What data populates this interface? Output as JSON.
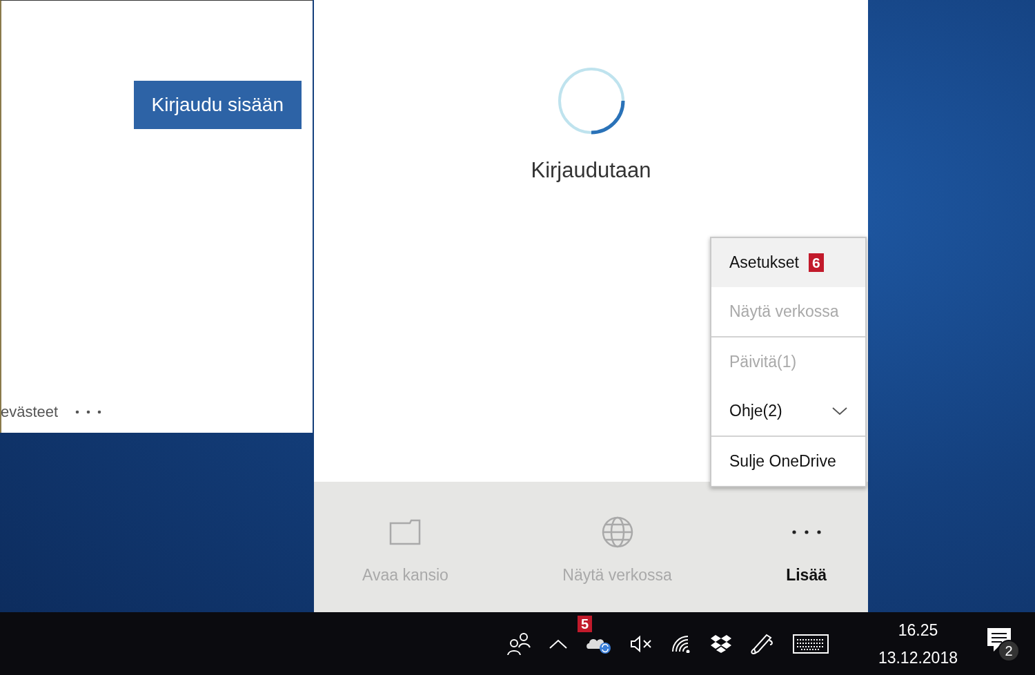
{
  "signin_window": {
    "button": "Kirjaudu sisään",
    "footer_text": "evästeet"
  },
  "onedrive_panel": {
    "status": "Kirjaudutaan",
    "menu": {
      "groups": [
        [
          {
            "label": "Asetukset",
            "disabled": false,
            "highlighted": true,
            "badge": "6"
          },
          {
            "label": "Näytä verkossa",
            "disabled": true,
            "highlighted": false
          }
        ],
        [
          {
            "label": "Päivitä(1)",
            "disabled": true,
            "highlighted": false
          },
          {
            "label": "Ohje(2)",
            "disabled": false,
            "highlighted": false,
            "submenu": true
          }
        ],
        [
          {
            "label": "Sulje OneDrive",
            "disabled": false,
            "highlighted": false
          }
        ]
      ]
    },
    "actions": [
      {
        "kind": "folder",
        "label": "Avaa kansio",
        "disabled": true
      },
      {
        "kind": "globe",
        "label": "Näytä verkossa",
        "disabled": true
      },
      {
        "kind": "more",
        "label": "Lisää",
        "disabled": false
      }
    ]
  },
  "taskbar": {
    "tray": [
      {
        "kind": "people"
      },
      {
        "kind": "chevron"
      },
      {
        "kind": "cloud",
        "badge": "5"
      },
      {
        "kind": "muted"
      },
      {
        "kind": "wifi"
      },
      {
        "kind": "dropbox"
      },
      {
        "kind": "pen"
      },
      {
        "kind": "keyboard"
      }
    ],
    "time": "16.25",
    "date": "13.12.2018",
    "notification_count": "2"
  }
}
